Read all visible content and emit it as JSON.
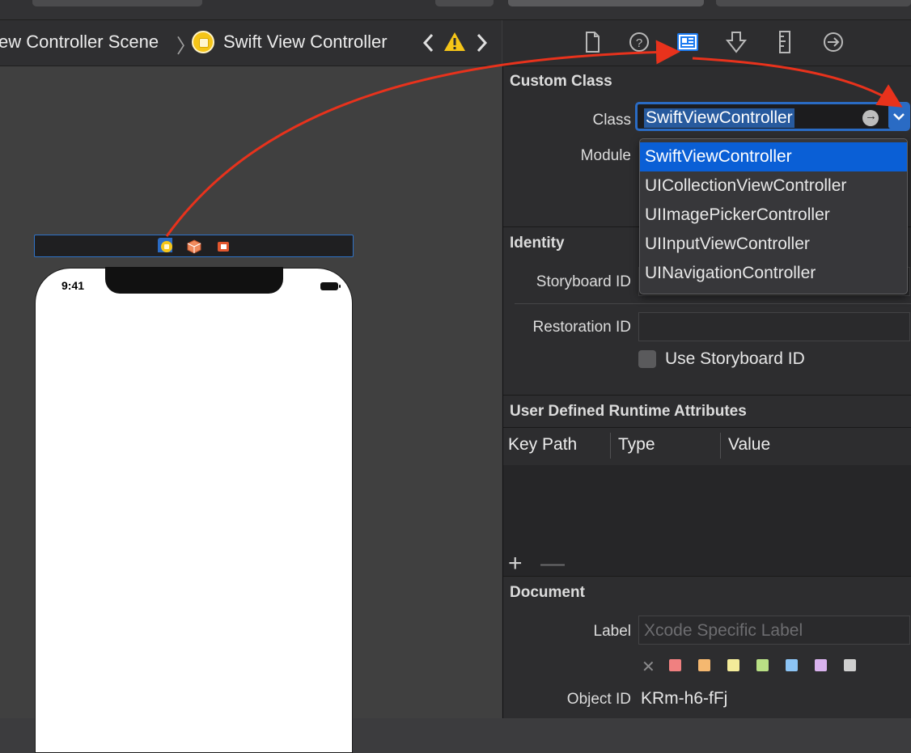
{
  "breadcrumb": {
    "scene_partial": "ew Controller Scene",
    "controller": "Swift View Controller"
  },
  "phone": {
    "time": "9:41"
  },
  "inspector": {
    "tabs": [
      "file-icon",
      "help-icon",
      "identity-icon",
      "attributes-icon",
      "size-icon",
      "connections-icon"
    ],
    "custom_class": {
      "title": "Custom Class",
      "class_label": "Class",
      "class_value": "SwiftViewController",
      "module_label": "Module"
    },
    "class_options": [
      "SwiftViewController",
      "UICollectionViewController",
      "UIImagePickerController",
      "UIInputViewController",
      "UINavigationController"
    ],
    "identity": {
      "title": "Identity",
      "storyboard_id_label": "Storyboard ID",
      "restoration_id_label": "Restoration ID",
      "use_storyboard_id_label": "Use Storyboard ID"
    },
    "runtime_attributes": {
      "title": "User Defined Runtime Attributes",
      "columns": [
        "Key Path",
        "Type",
        "Value"
      ],
      "add_label": "+",
      "remove_label": "—"
    },
    "document": {
      "title": "Document",
      "label_label": "Label",
      "label_placeholder": "Xcode Specific Label",
      "clear_label": "✕",
      "colors": [
        "#f08080",
        "#f5b870",
        "#f4ec9a",
        "#b9e085",
        "#8cc4f5",
        "#d9b2ee",
        "#cfcfcf"
      ],
      "object_id_label": "Object ID",
      "object_id_value": "KRm-h6-fFj"
    }
  },
  "colors": {
    "accent": "#2a6bc4",
    "selection": "#0a5fd6",
    "annotation_arrow": "#e8321c"
  }
}
